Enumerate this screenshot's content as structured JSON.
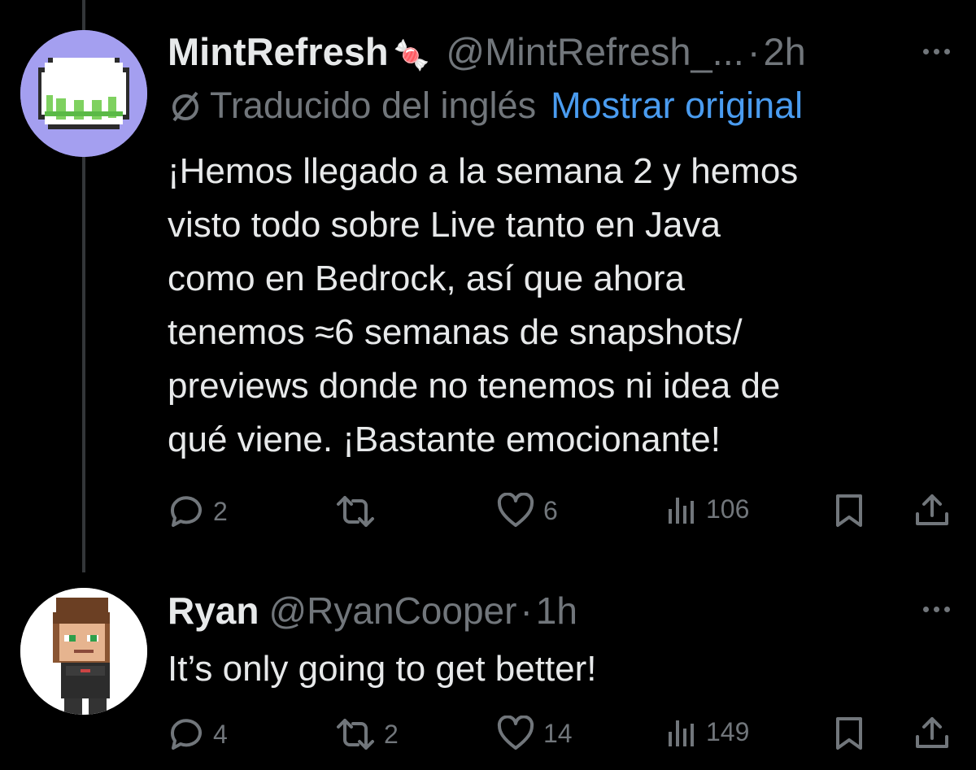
{
  "tweet1": {
    "name": "MintRefresh",
    "name_emoji": "🍬",
    "handle": "@MintRefresh_...",
    "separator": "·",
    "time": "2h",
    "translated_label": "Traducido del inglés",
    "show_original": "Mostrar original",
    "text": "¡Hemos llegado a la semana 2 y hemos\nvisto todo sobre Live tanto en Java\ncomo en Bedrock, así que ahora\ntenemos ≈6 semanas de snapshots/\npreviews donde no tenemos ni idea de\nqué viene. ¡Bastante emocionante!",
    "replies": "2",
    "reposts": "",
    "likes": "6",
    "views": "106"
  },
  "tweet2": {
    "name": "Ryan",
    "handle": "@RyanCooper",
    "separator": "·",
    "time": "1h",
    "text": "It’s only going to get better!",
    "replies": "4",
    "reposts": "2",
    "likes": "14",
    "views": "149"
  },
  "icons": [
    "reply-icon",
    "repost-icon",
    "like-icon",
    "views-icon",
    "bookmark-icon",
    "share-icon",
    "translate-icon",
    "more-icon"
  ],
  "colors": {
    "background": "#000000",
    "text": "#e7e9ea",
    "muted": "#71767b",
    "link": "#4a9cf0",
    "thread_line": "#333639"
  }
}
